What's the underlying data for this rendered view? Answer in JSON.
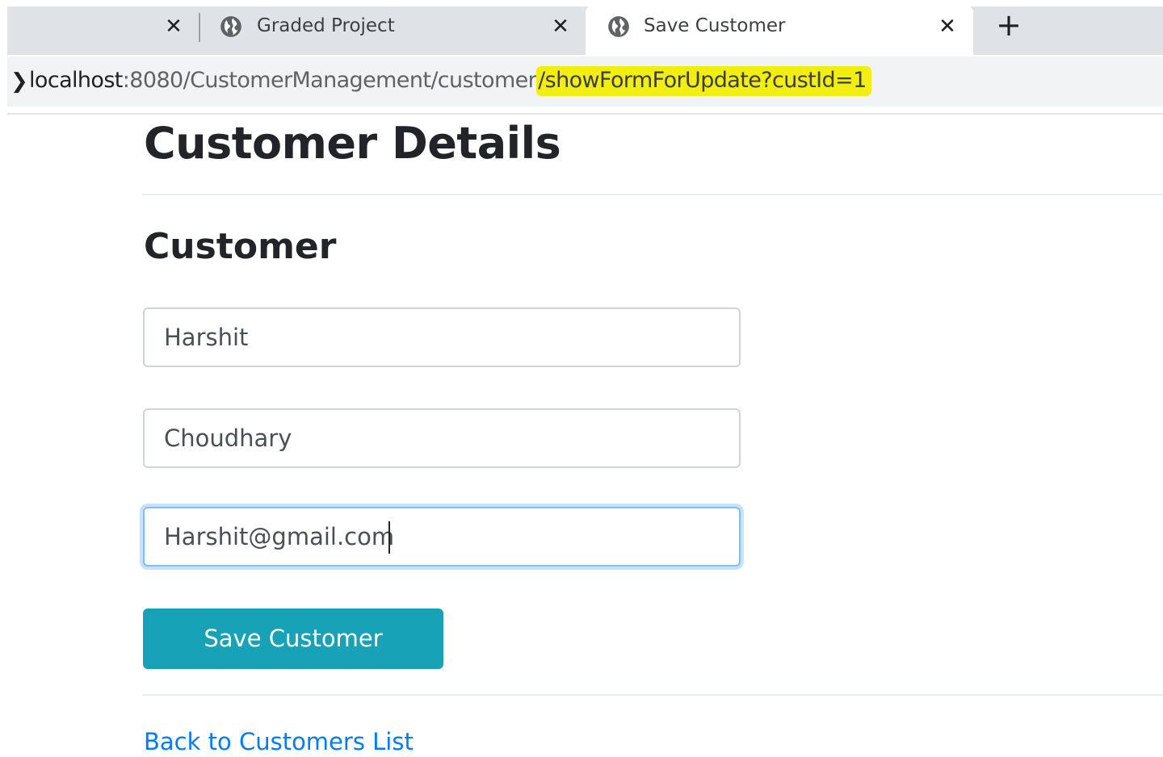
{
  "browser": {
    "tabs": [
      {
        "title": "Graded Project",
        "active": false
      },
      {
        "title": "Save Customer",
        "active": true
      }
    ],
    "close_glyph": "✕",
    "new_tab_glyph": "+",
    "address": {
      "host": "localhost",
      "path": ":8080/CustomerManagement/customer",
      "highlighted": "/showFormForUpdate?custId=1",
      "highlight_color": "#f2ee11"
    }
  },
  "page": {
    "title": "Customer Details",
    "section_title": "Customer",
    "form": {
      "first_name": "Harshit",
      "last_name": "Choudhary",
      "email": "Harshit@gmail.com",
      "submit_label": "Save Customer"
    },
    "back_link": "Back to Customers List"
  },
  "colors": {
    "button": "#17a2b8",
    "link": "#007bff",
    "focus_border": "#80bdff"
  }
}
